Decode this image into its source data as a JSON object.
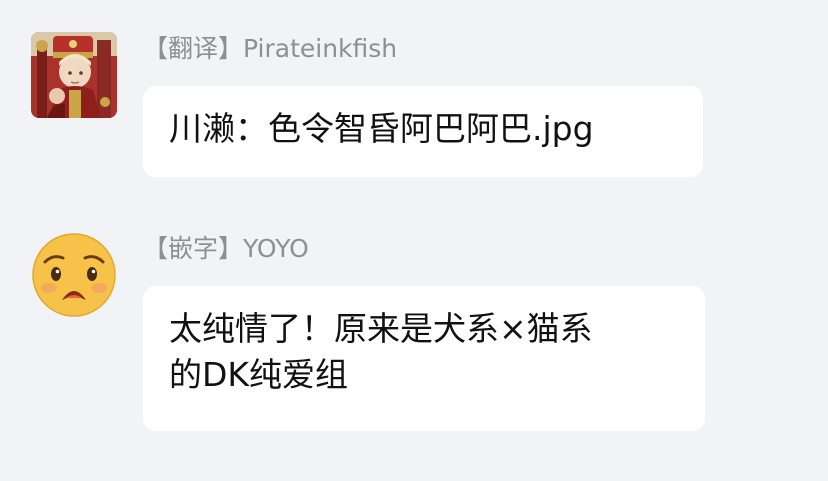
{
  "messages": [
    {
      "tag": "【翻译】",
      "name": "Pirateinkfish",
      "text": "川濑：色令智昏阿巴阿巴.jpg",
      "avatar_icon": "anime-character-avatar-icon"
    },
    {
      "tag": "【嵌字】",
      "name": "YOYO",
      "text": "太纯情了！原来是犬系×猫系\n的DK纯爱组",
      "avatar_icon": "sad-emoji-avatar-icon"
    }
  ],
  "colors": {
    "background": "#f2f3f7",
    "bubble": "#ffffff",
    "sender_text": "#8e8e93",
    "message_text": "#111111",
    "emoji_face": "#f6c24a"
  }
}
